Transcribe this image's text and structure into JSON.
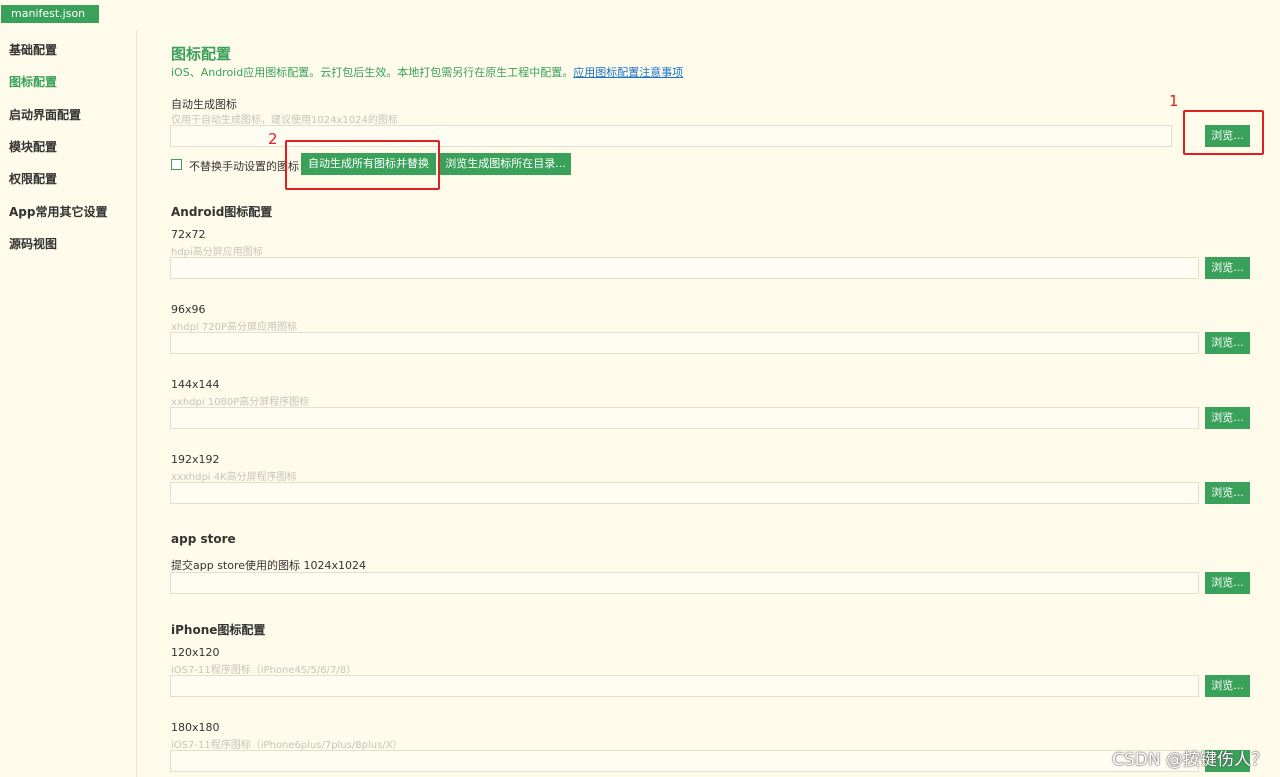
{
  "tab": {
    "label": "manifest.json"
  },
  "sidebar": {
    "items": [
      {
        "label": "基础配置"
      },
      {
        "label": "图标配置"
      },
      {
        "label": "启动界面配置"
      },
      {
        "label": "模块配置"
      },
      {
        "label": "权限配置"
      },
      {
        "label": "App常用其它设置"
      },
      {
        "label": "源码视图"
      }
    ],
    "active_index": 1
  },
  "main": {
    "title": "图标配置",
    "description": "iOS、Android应用图标配置。云打包后生效。本地打包需另行在原生工程中配置。",
    "description_link": "应用图标配置注意事项",
    "auto": {
      "label": "自动生成图标",
      "hint": "仅用于自动生成图标，建议使用1024x1024的图标",
      "input_value": "",
      "browse_label": "浏览...",
      "checkbox_label": "不替换手动设置的图标",
      "checkbox_checked": false,
      "generate_label": "自动生成所有图标并替换",
      "browse_dir_label": "浏览生成图标所在目录..."
    },
    "android": {
      "title": "Android图标配置",
      "items": [
        {
          "label": "72x72",
          "hint": "hdpi高分屏应用图标",
          "value": "",
          "browse_label": "浏览..."
        },
        {
          "label": "96x96",
          "hint": "xhdpi 720P高分屏应用图标",
          "value": "",
          "browse_label": "浏览..."
        },
        {
          "label": "144x144",
          "hint": "xxhdpi 1080P高分屏程序图标",
          "value": "",
          "browse_label": "浏览..."
        },
        {
          "label": "192x192",
          "hint": "xxxhdpi 4K高分屏程序图标",
          "value": "",
          "browse_label": "浏览..."
        }
      ]
    },
    "appstore": {
      "title": "app store",
      "label": "提交app store使用的图标 1024x1024",
      "value": "",
      "browse_label": "浏览..."
    },
    "iphone": {
      "title": "iPhone图标配置",
      "items": [
        {
          "label": "120x120",
          "hint": "iOS7-11程序图标（iPhone4S/5/6/7/8）",
          "value": "",
          "browse_label": "浏览..."
        },
        {
          "label": "180x180",
          "hint": "iOS7-11程序图标（iPhone6plus/7plus/8plus/X）",
          "value": ""
        }
      ]
    }
  },
  "annotations": {
    "marker1": "1",
    "marker2": "2"
  },
  "watermark": "CSDN @按键伤人？",
  "colors": {
    "accent": "#3aa15a",
    "background": "#fffbeb",
    "annotation": "#e02020",
    "link": "#1a75c7"
  }
}
